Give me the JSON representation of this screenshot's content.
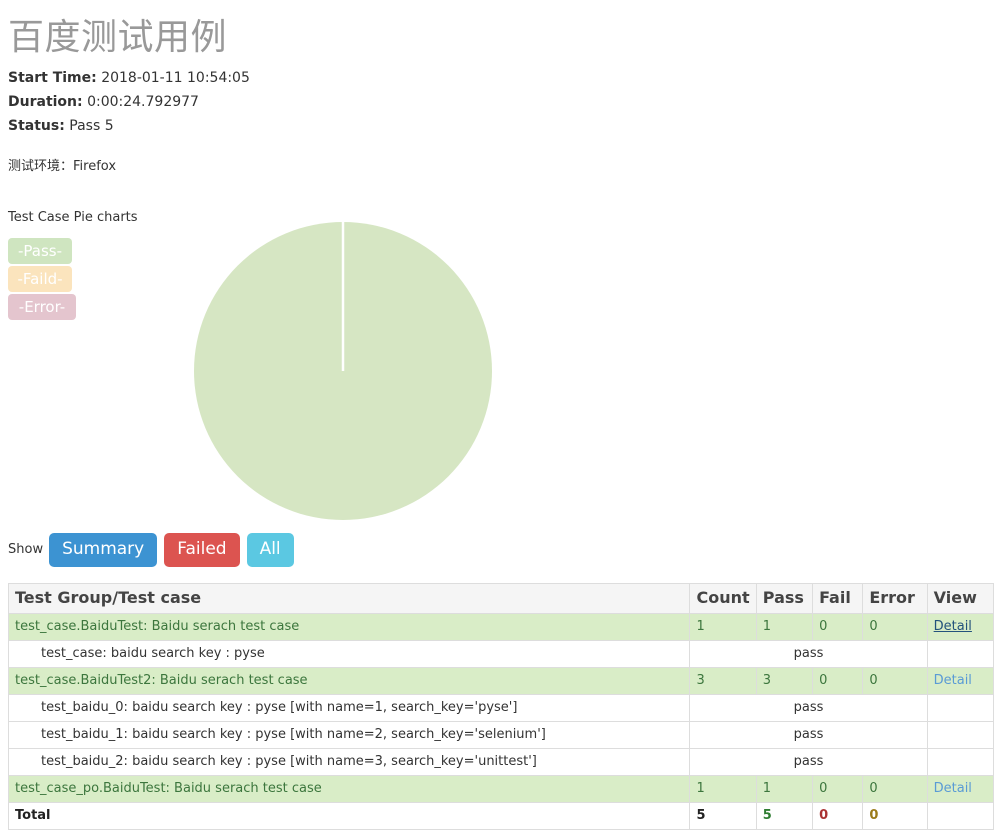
{
  "report": {
    "title": "百度测试用例",
    "start_time_label": "Start Time:",
    "start_time_value": "2018-01-11 10:54:05",
    "duration_label": "Duration:",
    "duration_value": "0:00:24.792977",
    "status_label": "Status:",
    "status_value": "Pass 5",
    "environment_line": "测试环境：Firefox"
  },
  "chart": {
    "caption": "Test Case Pie charts",
    "legend": [
      {
        "label": "-Pass-",
        "color": "#cfe5c0"
      },
      {
        "label": "-Faild-",
        "color": "#fbe4bd"
      },
      {
        "label": "-Error-",
        "color": "#e4c5ce"
      }
    ]
  },
  "chart_data": {
    "type": "pie",
    "title": "Test Case Pie charts",
    "categories": [
      "Pass",
      "Faild",
      "Error"
    ],
    "values": [
      5,
      0,
      0
    ],
    "colors": [
      "#d6e6c3",
      "#fbe4bd",
      "#e4c5ce"
    ],
    "legend_position": "left",
    "total": 5,
    "start_angle": 90,
    "slice_border_color": "#ffffff"
  },
  "filters": {
    "show_label": "Show",
    "buttons": [
      {
        "label": "Summary",
        "color": "#3c93d2"
      },
      {
        "label": "Failed",
        "color": "#dc5450"
      },
      {
        "label": "All",
        "color": "#5bc8e2"
      }
    ]
  },
  "table": {
    "headers": {
      "name": "Test Group/Test case",
      "count": "Count",
      "pass": "Pass",
      "fail": "Fail",
      "error": "Error",
      "view": "View"
    },
    "rows": [
      {
        "kind": "group",
        "name": "test_case.BaiduTest: Baidu serach test case",
        "count": "1",
        "pass": "1",
        "fail": "0",
        "error": "0",
        "view": "Detail",
        "view_hovered": true
      },
      {
        "kind": "case",
        "name": "test_case: baidu search key : pyse",
        "status": "pass"
      },
      {
        "kind": "group",
        "name": "test_case.BaiduTest2: Baidu serach test case",
        "count": "3",
        "pass": "3",
        "fail": "0",
        "error": "0",
        "view": "Detail",
        "view_hovered": false
      },
      {
        "kind": "case",
        "name": "test_baidu_0: baidu search key : pyse [with name=1, search_key='pyse']",
        "status": "pass"
      },
      {
        "kind": "case",
        "name": "test_baidu_1: baidu search key : pyse [with name=2, search_key='selenium']",
        "status": "pass"
      },
      {
        "kind": "case",
        "name": "test_baidu_2: baidu search key : pyse [with name=3, search_key='unittest']",
        "status": "pass"
      },
      {
        "kind": "group",
        "name": "test_case_po.BaiduTest: Baidu serach test case",
        "count": "1",
        "pass": "1",
        "fail": "0",
        "error": "0",
        "view": "Detail",
        "view_hovered": false
      }
    ],
    "total": {
      "name": "Total",
      "count": "5",
      "pass": "5",
      "fail": "0",
      "error": "0",
      "view": ""
    }
  }
}
